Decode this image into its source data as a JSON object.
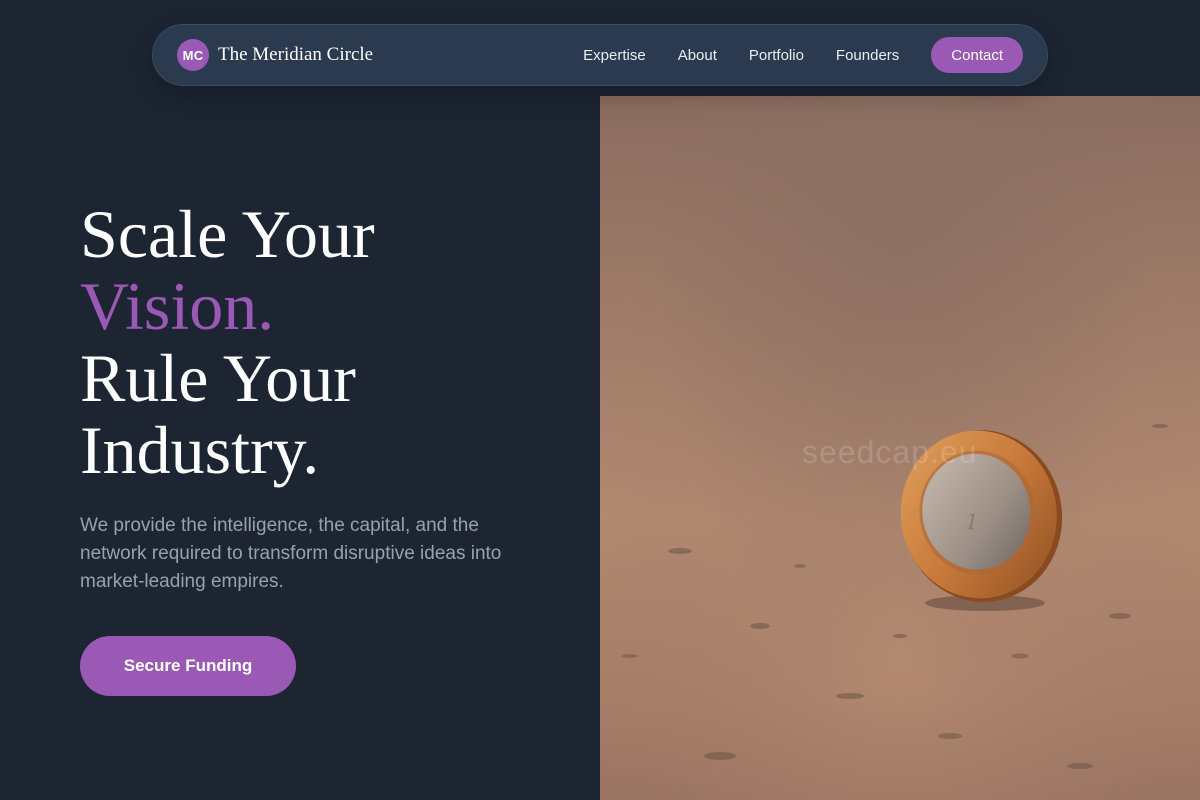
{
  "nav": {
    "brand_initials": "MC",
    "brand_name": "The Meridian Circle",
    "links": [
      "Expertise",
      "About",
      "Portfolio",
      "Founders"
    ],
    "cta": "Contact"
  },
  "hero": {
    "title_line1": "Scale Your",
    "title_line2": "Vision.",
    "title_line3": "Rule Your",
    "title_line4": "Industry.",
    "subtitle": "We provide the intelligence, the capital, and the network required to transform disruptive ideas into market-leading empires.",
    "button": "Secure Funding",
    "image_watermark": "seedcap.eu"
  },
  "colors": {
    "background": "#1d2533",
    "nav_bg": "#2b3a4e",
    "accent": "#9b59b6",
    "muted_text": "#96a1b0"
  },
  "icons": [
    "coin-photo"
  ]
}
